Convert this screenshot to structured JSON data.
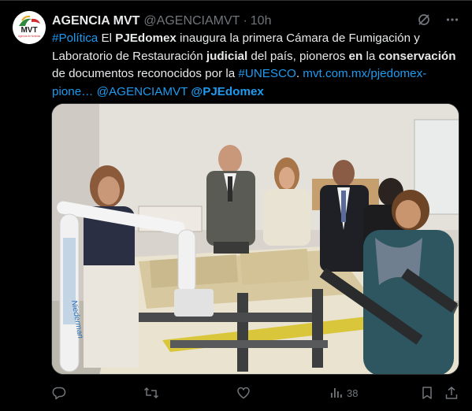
{
  "tweet": {
    "author_name": "AGENCIA MVT",
    "author_handle": "@AGENCIAMVT",
    "separator": "·",
    "time": "10h",
    "avatar_text": "MVT",
    "avatar_subtext": "Agencia de Noticias",
    "text_parts": {
      "hashtag_politica": "#Política",
      "t1": " El ",
      "pjedomex": "PJEdomex",
      "t2": " inaugura la primera Cámara de Fumigación y Laboratorio de Restauración ",
      "judicial": "judicial",
      "t3": " del país, pioneros ",
      "en": "en",
      "t4": " la ",
      "conservacion": "conservación",
      "t5": " de documentos reconocidos por la ",
      "hashtag_unesco": "#UNESCO",
      "t6": ". ",
      "url": "mvt.com.mx/pjedomex-pione…",
      "t7": " ",
      "mention_agencia": "@AGENCIAMVT",
      "t8": " ",
      "mention_pjedomex": "@PJEdomex"
    },
    "image_arm_label": "Niederman",
    "actions": {
      "reply_count": "",
      "retweet_count": "",
      "like_count": "",
      "views_count": "38"
    }
  },
  "colors": {
    "background": "#000000",
    "text": "#e7e9ea",
    "muted": "#71767b",
    "link": "#1d9bf0",
    "avatar_red": "#d3292f",
    "avatar_green": "#2e8b3e"
  }
}
